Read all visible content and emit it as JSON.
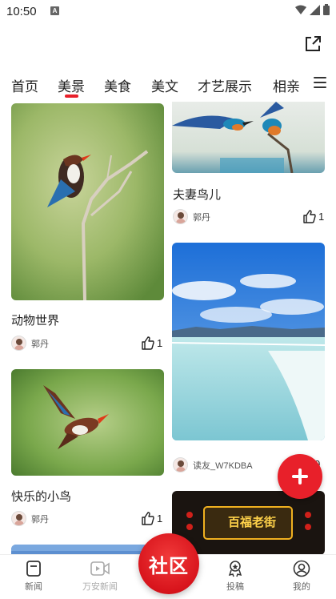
{
  "status": {
    "time": "10:50",
    "notif": "A"
  },
  "tabs": [
    {
      "label": "首页"
    },
    {
      "label": "美景",
      "active": true
    },
    {
      "label": "美食"
    },
    {
      "label": "美文"
    },
    {
      "label": "才艺展示"
    },
    {
      "label": "相亲"
    }
  ],
  "cards": [
    {
      "title": "动物世界",
      "author": "郭丹",
      "likes": "1",
      "image": "kingfisher-on-branch"
    },
    {
      "title": "快乐的小鸟",
      "author": "郭丹",
      "likes": "1",
      "image": "kingfisher-in-flight"
    },
    {
      "title": "夫妻鸟儿",
      "author": "郭丹",
      "likes": "1",
      "image": "two-kingfishers"
    },
    {
      "title": "",
      "author": "读友_W7KDBA",
      "likes": "0",
      "image": "salt-lake-shore"
    },
    {
      "title": "",
      "author": "",
      "likes": "",
      "image": "night-restaurant-sign",
      "sign_text": "百福老街"
    }
  ],
  "bottom_nav": [
    {
      "label": "新闻",
      "icon": "news-icon"
    },
    {
      "label": "万安新闻",
      "icon": "video-icon"
    },
    {
      "label": "社区",
      "icon": "community-icon"
    },
    {
      "label": "投稿",
      "icon": "submit-award-icon"
    },
    {
      "label": "我的",
      "icon": "profile-icon"
    }
  ],
  "colors": {
    "accent": "#e8202a"
  }
}
